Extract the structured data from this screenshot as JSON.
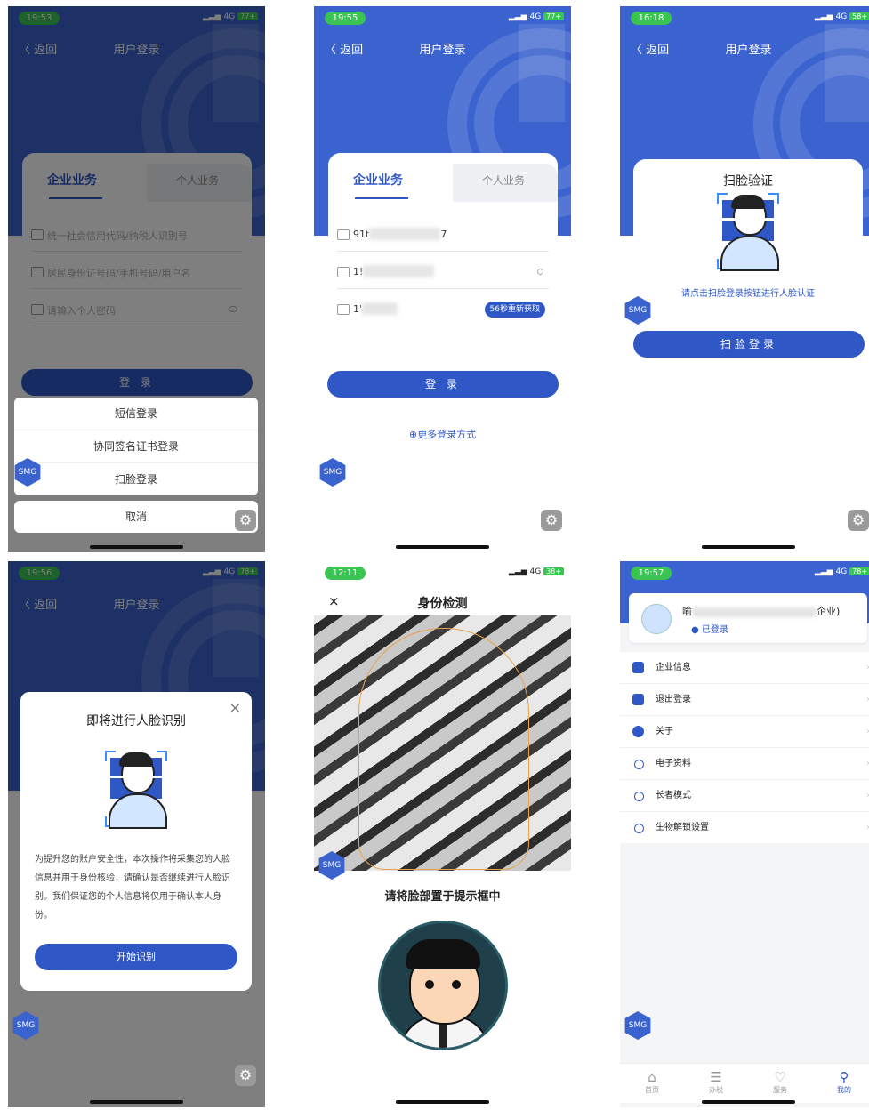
{
  "colors": {
    "primary": "#2f57c6",
    "header": "#3b63cf",
    "status_green": "#3ac452"
  },
  "common": {
    "back": "〈 返回",
    "title": "用户登录",
    "tab_enterprise": "企业业务",
    "tab_personal": "个人业务",
    "login": "登 录",
    "logo": "SMG",
    "gear_icon": "⚙",
    "network": "4G"
  },
  "panel1": {
    "time": "19:53",
    "battery": "77+",
    "credit_code_placeholder": "统一社会信用代码/纳税人识别号",
    "id_placeholder": "居民身份证号码/手机号码/用户名",
    "password_placeholder": "请输入个人密码",
    "sheet": [
      "短信登录",
      "协同签名证书登录",
      "扫脸登录"
    ],
    "cancel": "取消"
  },
  "panel2": {
    "time": "19:55",
    "battery": "77+",
    "field1_value": "91t",
    "field1_tail": "7",
    "field2_value": "1!",
    "field3_value": "1'",
    "sms_button": "56秒重新获取",
    "more_methods": "⊕更多登录方式"
  },
  "panel3": {
    "time": "16:18",
    "battery": "58+",
    "scan_title": "扫脸验证",
    "scan_hint": "请点击扫脸登录按钮进行人脸认证",
    "scan_login": "扫脸登录"
  },
  "panel4": {
    "time": "19:56",
    "battery": "78+",
    "modal_title": "即将进行人脸识别",
    "close": "×",
    "description": "为提升您的账户安全性，本次操作将采集您的人脸信息并用于身份核验，请确认是否继续进行人脸识别。我们保证您的个人信息将仅用于确认本人身份。",
    "start": "开始识别"
  },
  "panel5": {
    "time": "12:11",
    "battery": "38+",
    "close": "×",
    "title": "身份检测",
    "prompt": "请将脸部置于提示框中"
  },
  "panel6": {
    "time": "19:57",
    "battery": "78+",
    "name_prefix": "喻",
    "name_suffix": "企业)",
    "logged_in": "已登录",
    "menu": [
      "企业信息",
      "退出登录",
      "关于",
      "电子资料",
      "长者模式",
      "生物解锁设置"
    ],
    "tabs": [
      "首页",
      "办税",
      "服务",
      "我的"
    ],
    "tab_icons": [
      "⌂",
      "☰",
      "♡",
      "⚲"
    ]
  }
}
